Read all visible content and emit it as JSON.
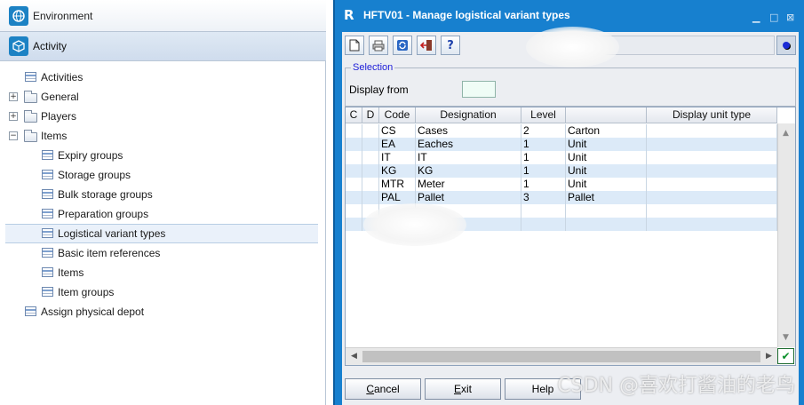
{
  "nav": {
    "environment_label": "Environment",
    "activity_label": "Activity",
    "items": [
      {
        "label": "Activities",
        "type": "table",
        "level": 0,
        "expander": ""
      },
      {
        "label": "General",
        "type": "folder",
        "level": 0,
        "expander": "+"
      },
      {
        "label": "Players",
        "type": "folder",
        "level": 0,
        "expander": "+"
      },
      {
        "label": "Items",
        "type": "folder",
        "level": 0,
        "expander": "−"
      },
      {
        "label": "Expiry groups",
        "type": "table",
        "level": 1,
        "expander": ""
      },
      {
        "label": "Storage groups",
        "type": "table",
        "level": 1,
        "expander": ""
      },
      {
        "label": "Bulk storage groups",
        "type": "table",
        "level": 1,
        "expander": ""
      },
      {
        "label": "Preparation groups",
        "type": "table",
        "level": 1,
        "expander": ""
      },
      {
        "label": "Logistical variant types",
        "type": "table",
        "level": 1,
        "expander": "",
        "selected": true
      },
      {
        "label": "Basic item references",
        "type": "table",
        "level": 1,
        "expander": ""
      },
      {
        "label": "Items",
        "type": "table",
        "level": 1,
        "expander": ""
      },
      {
        "label": "Item groups",
        "type": "table",
        "level": 1,
        "expander": ""
      },
      {
        "label": "Assign physical depot",
        "type": "table",
        "level": 0,
        "expander": ""
      }
    ]
  },
  "window": {
    "logo": "R",
    "title": "HFTV01 - Manage logistical variant types",
    "toolbar_icons": [
      "new-document-icon",
      "print-icon",
      "refresh-icon",
      "exit-door-icon",
      "help-icon"
    ],
    "help_glyph": "?"
  },
  "selection": {
    "legend": "Selection",
    "display_from_label": "Display from",
    "display_from_value": ""
  },
  "grid": {
    "columns": [
      "C",
      "D",
      "Code",
      "Designation",
      "Level",
      "",
      "Display unit type"
    ],
    "rows": [
      {
        "c": "",
        "d": "",
        "code": "CS",
        "designation": "Cases",
        "level": "2",
        "unit": "Carton",
        "display": ""
      },
      {
        "c": "",
        "d": "",
        "code": "EA",
        "designation": "Eaches",
        "level": "1",
        "unit": "Unit",
        "display": ""
      },
      {
        "c": "",
        "d": "",
        "code": "IT",
        "designation": "IT",
        "level": "1",
        "unit": "Unit",
        "display": ""
      },
      {
        "c": "",
        "d": "",
        "code": "KG",
        "designation": "KG",
        "level": "1",
        "unit": "Unit",
        "display": ""
      },
      {
        "c": "",
        "d": "",
        "code": "MTR",
        "designation": "Meter",
        "level": "1",
        "unit": "Unit",
        "display": ""
      },
      {
        "c": "",
        "d": "",
        "code": "PAL",
        "designation": "Pallet",
        "level": "3",
        "unit": "Pallet",
        "display": ""
      },
      {
        "c": "",
        "d": "",
        "code": "",
        "designation": "",
        "level": "",
        "unit": "",
        "display": ""
      },
      {
        "c": "",
        "d": "",
        "code": "",
        "designation": "",
        "level": "",
        "unit": "",
        "display": ""
      }
    ]
  },
  "buttons": {
    "cancel_mnemonic": "C",
    "cancel_rest": "ancel",
    "exit_mnemonic": "E",
    "exit_rest": "xit",
    "help_label": "Help"
  },
  "watermark": "CSDN @喜欢打酱油的老鸟"
}
